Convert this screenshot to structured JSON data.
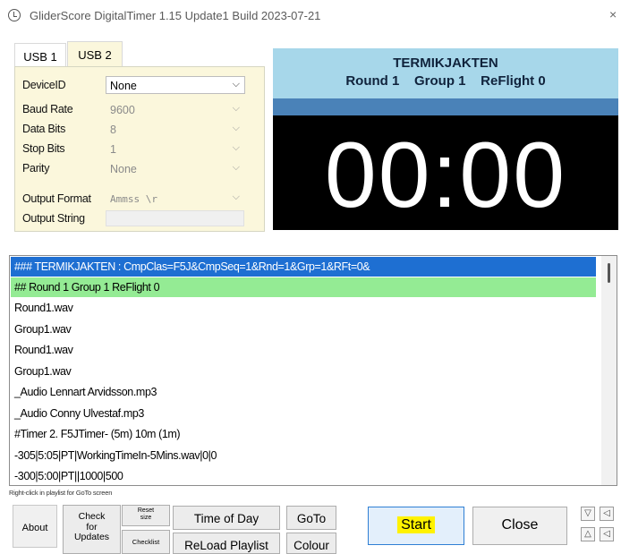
{
  "window": {
    "title": "GliderScore DigitalTimer 1.15 Update1  Build 2023-07-21",
    "close_glyph": "×"
  },
  "tabs": [
    {
      "label": "USB 1"
    },
    {
      "label": "USB 2"
    }
  ],
  "settings": {
    "device_id": {
      "label": "DeviceID",
      "value": "None"
    },
    "baud_rate": {
      "label": "Baud Rate",
      "value": "9600"
    },
    "data_bits": {
      "label": "Data Bits",
      "value": "8"
    },
    "stop_bits": {
      "label": "Stop Bits",
      "value": "1"
    },
    "parity": {
      "label": "Parity",
      "value": "None"
    },
    "output_format": {
      "label": "Output Format",
      "value": "Ammss \\r"
    },
    "output_string": {
      "label": "Output String",
      "value": ""
    }
  },
  "display": {
    "competition": "TERMIKJAKTEN",
    "round_line": "Round 1    Group 1    ReFlight 0",
    "clock": "00:00",
    "colors": {
      "header_bg": "#a7d7ea",
      "band": "#4a82b8",
      "clock_bg": "#000000"
    }
  },
  "playlist": {
    "rows": [
      "### TERMIKJAKTEN : CmpClas=F5J&CmpSeq=1&Rnd=1&Grp=1&RFt=0&",
      "## Round 1   Group 1   ReFlight 0",
      "Round1.wav",
      "Group1.wav",
      "Round1.wav",
      "Group1.wav",
      "_Audio Lennart Arvidsson.mp3",
      "_Audio Conny Ulvestaf.mp3",
      "#Timer 2. F5JTimer- (5m) 10m (1m)",
      "-305|5:05|PT|WorkingTimeIn-5Mins.wav|0|0",
      "-300|5:00|PT||1000|500"
    ],
    "hint": "Right-click in playlist for GoTo screen"
  },
  "buttons": {
    "about": "About",
    "check_updates": [
      "Check",
      "for",
      "Updates"
    ],
    "reset_size": [
      "Reset",
      "size"
    ],
    "checklist": "Checklist",
    "time_of_day": "Time of Day",
    "reload_playlist": "ReLoad Playlist",
    "goto": "GoTo",
    "colour": "Colour",
    "start": "Start",
    "close": "Close"
  },
  "icons": [
    "clock-icon",
    "chevron-down-icon",
    "triangle-down-icon",
    "triangle-left-icon",
    "triangle-up-icon"
  ]
}
